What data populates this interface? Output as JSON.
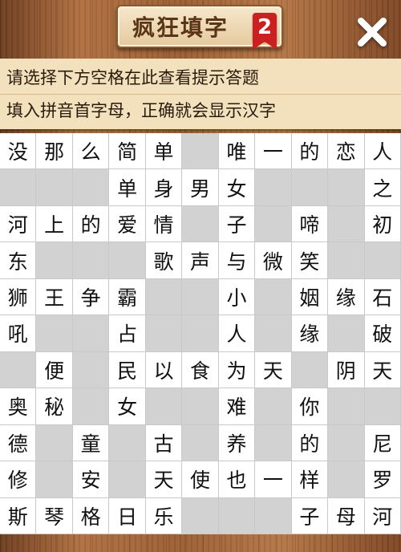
{
  "header": {
    "title": "疯狂填字",
    "level": "2"
  },
  "hints": {
    "line1": "请选择下方空格在此查看提示答题",
    "line2": "填入拼音首字母，正确就会显示汉字"
  },
  "grid": {
    "rows": [
      [
        "没",
        "那",
        "么",
        "简",
        "单",
        "",
        "唯",
        "一",
        "的",
        "恋",
        "人"
      ],
      [
        "",
        "",
        "",
        "单",
        "身",
        "男",
        "女",
        "",
        "",
        "",
        "之"
      ],
      [
        "河",
        "上",
        "的",
        "爱",
        "情",
        "",
        "子",
        "",
        "啼",
        "",
        "初"
      ],
      [
        "东",
        "",
        "",
        "",
        "歌",
        "声",
        "与",
        "微",
        "笑",
        "",
        ""
      ],
      [
        "狮",
        "王",
        "争",
        "霸",
        "",
        "",
        "小",
        "",
        "姻",
        "缘",
        "石"
      ],
      [
        "吼",
        "",
        "",
        "占",
        "",
        "",
        "人",
        "",
        "缘",
        "",
        "破"
      ],
      [
        "",
        "便",
        "",
        "民",
        "以",
        "食",
        "为",
        "天",
        "",
        "阴",
        "天"
      ],
      [
        "奥",
        "秘",
        "",
        "女",
        "",
        "",
        "难",
        "",
        "你",
        "",
        ""
      ],
      [
        "德",
        "",
        "童",
        "",
        "古",
        "",
        "养",
        "",
        "的",
        "",
        "尼"
      ],
      [
        "修",
        "",
        "安",
        "",
        "天",
        "使",
        "也",
        "一",
        "样",
        "",
        "罗"
      ],
      [
        "斯",
        "琴",
        "格",
        "日",
        "乐",
        "",
        "",
        "",
        "子",
        "母",
        "河"
      ]
    ]
  },
  "colors": {
    "blank_cell": "#d2d2d2",
    "badge": "#cc1f1f",
    "hint_bg": "#f3e0bd"
  }
}
